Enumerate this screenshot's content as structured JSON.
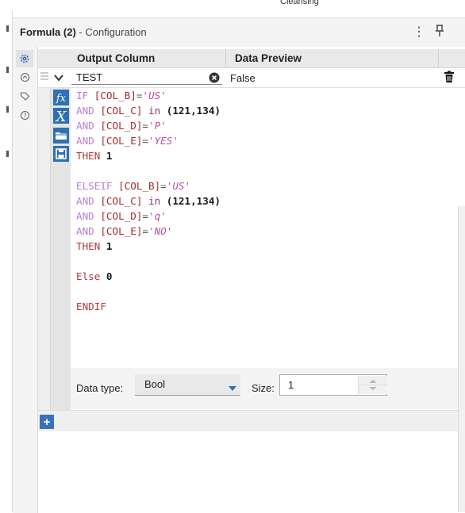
{
  "top_strip": {
    "label": "Cleansing"
  },
  "header": {
    "title_bold": "Formula (2)",
    "title_rest": " - Configuration"
  },
  "tabs": [
    {
      "name": "configuration"
    },
    {
      "name": "annotation"
    },
    {
      "name": "tag"
    },
    {
      "name": "help"
    }
  ],
  "grid": {
    "col_output": "Output Column",
    "col_preview": "Data Preview",
    "row": {
      "output_value": "TEST",
      "preview_value": "False"
    }
  },
  "expression_lines": [
    [
      [
        "kw",
        "IF "
      ],
      [
        "fld",
        "[COL_B]"
      ],
      [
        "op",
        "="
      ],
      [
        "str",
        "'US'"
      ]
    ],
    [
      [
        "kw",
        "AND "
      ],
      [
        "fld",
        "[COL_C] "
      ],
      [
        "kw2",
        "in "
      ],
      [
        "num",
        "(121,134)"
      ]
    ],
    [
      [
        "kw",
        "AND "
      ],
      [
        "fld",
        "[COL_D]"
      ],
      [
        "op",
        "="
      ],
      [
        "str",
        "'P'"
      ]
    ],
    [
      [
        "kw",
        "AND "
      ],
      [
        "fld",
        "[COL_E]"
      ],
      [
        "op",
        "="
      ],
      [
        "str",
        "'YES'"
      ]
    ],
    [
      [
        "kwthen",
        "THEN "
      ],
      [
        "num",
        "1"
      ]
    ],
    [],
    [
      [
        "kw",
        "ELSEIF "
      ],
      [
        "fld",
        "[COL_B]"
      ],
      [
        "op",
        "="
      ],
      [
        "str",
        "'US'"
      ]
    ],
    [
      [
        "kw",
        "AND "
      ],
      [
        "fld",
        "[COL_C] "
      ],
      [
        "kw2",
        "in "
      ],
      [
        "num",
        "(121,134)"
      ]
    ],
    [
      [
        "kw",
        "AND "
      ],
      [
        "fld",
        "[COL_D]"
      ],
      [
        "op",
        "="
      ],
      [
        "str",
        "'q'"
      ]
    ],
    [
      [
        "kw",
        "AND "
      ],
      [
        "fld",
        "[COL_E]"
      ],
      [
        "op",
        "="
      ],
      [
        "str",
        "'NO'"
      ]
    ],
    [
      [
        "kwthen",
        "THEN "
      ],
      [
        "num",
        "1"
      ]
    ],
    [],
    [
      [
        "kwthen",
        "Else "
      ],
      [
        "num",
        "0"
      ]
    ],
    [],
    [
      [
        "kwthen",
        "ENDIF"
      ]
    ]
  ],
  "bottom": {
    "data_type_label": "Data type:",
    "data_type_value": "Bool",
    "size_label": "Size:",
    "size_value": "1"
  },
  "colors": {
    "accent": "#3a72b9",
    "icon_blue": "#2f6fb3",
    "keyword": "#c07cd6",
    "field": "#a52a2a",
    "string": "#c04aa6"
  }
}
